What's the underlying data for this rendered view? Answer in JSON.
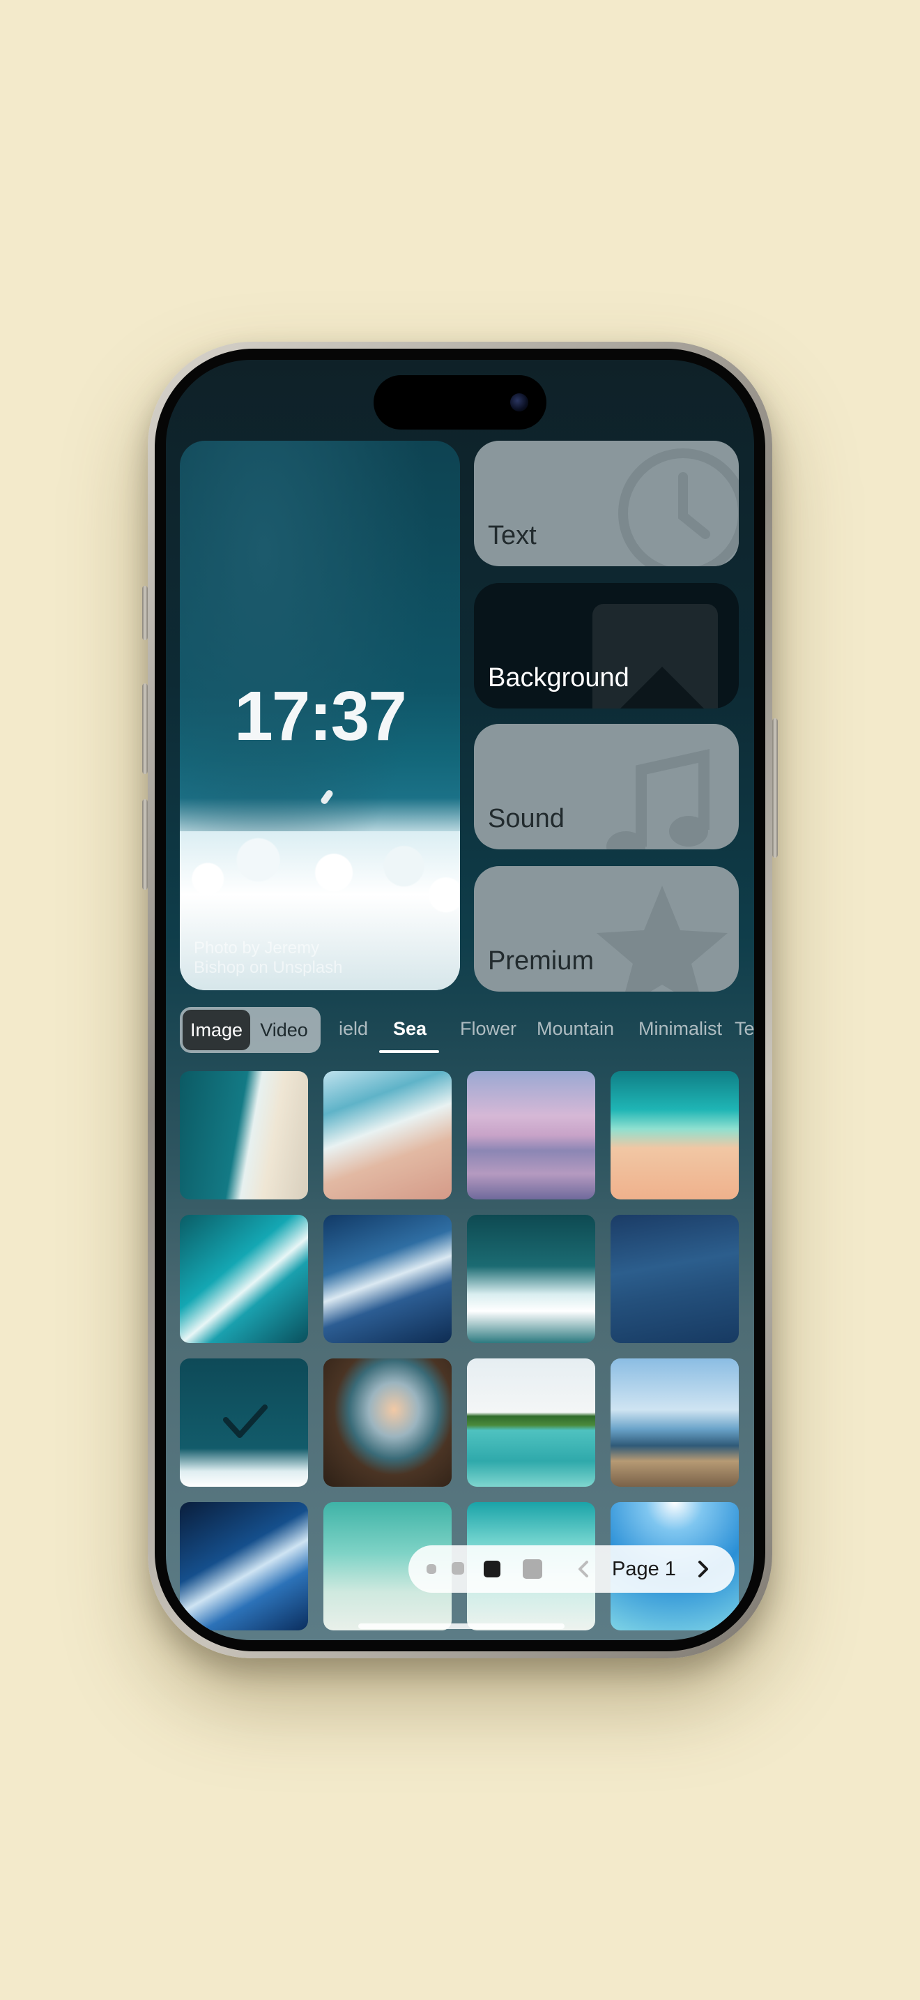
{
  "preview": {
    "time": "17:37",
    "credit": "Photo by Jeremy Bishop on Unsplash"
  },
  "tiles": [
    {
      "label": "Text",
      "icon": "clock-icon"
    },
    {
      "label": "Background",
      "icon": "image-icon"
    },
    {
      "label": "Sound",
      "icon": "music-note-icon"
    },
    {
      "label": "Premium",
      "icon": "star-icon"
    }
  ],
  "media_toggle": {
    "options": [
      "Image",
      "Video"
    ],
    "selected": "Image"
  },
  "categories": [
    "ield",
    "Sea",
    "Flower",
    "Mountain",
    "Minimalist",
    "Te"
  ],
  "selected_category": "Sea",
  "grid": {
    "items": [
      {
        "subject": "aerial wave on beach"
      },
      {
        "subject": "shoreline aerial"
      },
      {
        "subject": "pink sunset sea"
      },
      {
        "subject": "turquoise wave on sand"
      },
      {
        "subject": "aerial turquoise surf"
      },
      {
        "subject": "deep blue waves"
      },
      {
        "subject": "white foam waves"
      },
      {
        "subject": "dark blue ocean"
      },
      {
        "subject": "selected ocean surf",
        "selected": true
      },
      {
        "subject": "cave overlooking cliffs"
      },
      {
        "subject": "tropical island"
      },
      {
        "subject": "wooden pier"
      },
      {
        "subject": "dark blue wave"
      },
      {
        "subject": "starfish in shallow water"
      },
      {
        "subject": "turquoise shallows"
      },
      {
        "subject": "sunlit blue water"
      }
    ]
  },
  "pager": {
    "label": "Page 1",
    "prev_icon": "chevron-left-icon",
    "next_icon": "chevron-right-icon"
  },
  "colors": {
    "page_background": "#f3eacb",
    "tile_gray": "#8a979c",
    "tile_dark": "#07141a",
    "active_tab": "#ffffff"
  }
}
